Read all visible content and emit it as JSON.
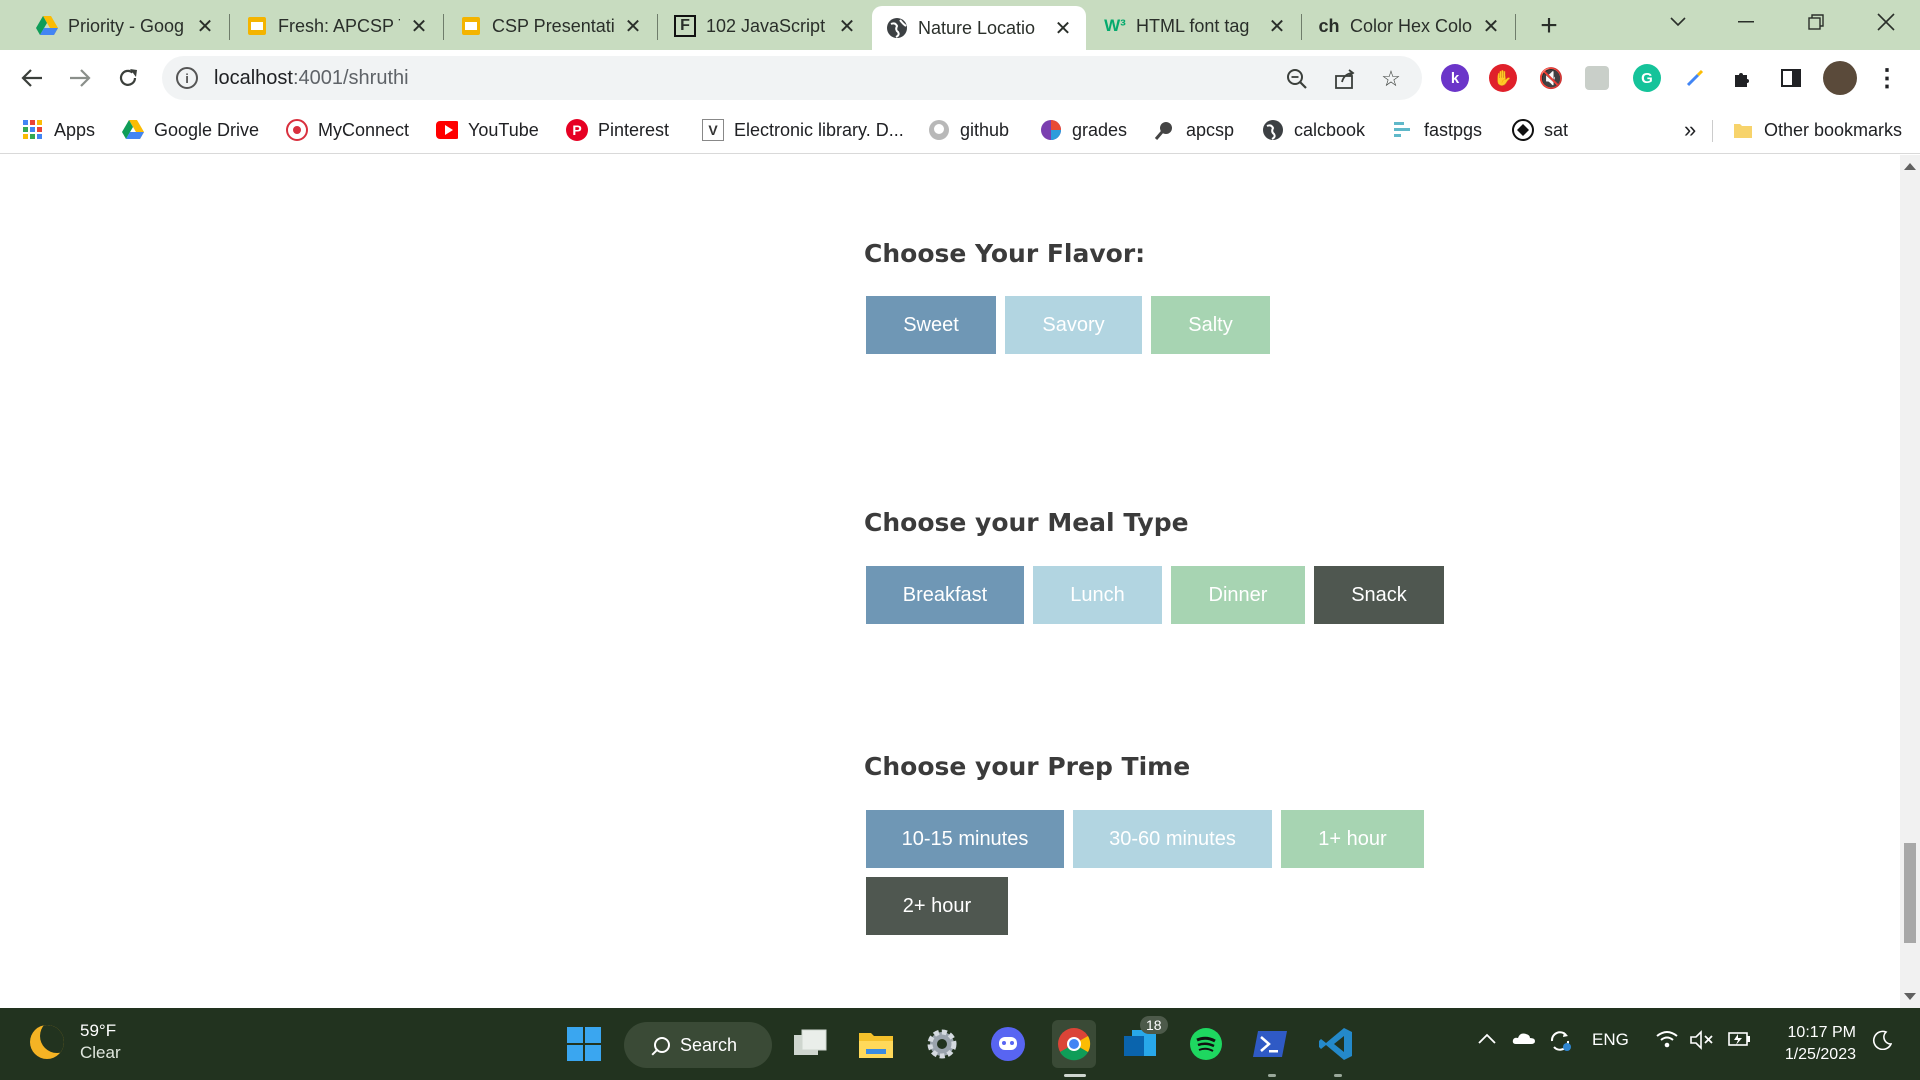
{
  "browser": {
    "tabs": [
      {
        "title": "Priority - Goog",
        "icon": "google-drive-icon",
        "active": false
      },
      {
        "title": "Fresh: APCSP T",
        "icon": "google-slides-icon",
        "active": false
      },
      {
        "title": "CSP Presentati",
        "icon": "google-slides-icon",
        "active": false
      },
      {
        "title": "102 JavaScript",
        "icon": "f-icon",
        "active": false
      },
      {
        "title": "Nature Locatio",
        "icon": "globe-icon",
        "active": true
      },
      {
        "title": "HTML font tag",
        "icon": "w3schools-icon",
        "active": false
      },
      {
        "title": "Color Hex Colo",
        "icon": "ch-icon",
        "active": false
      }
    ],
    "tab_icon_text": {
      "f": "F",
      "w3": "W³",
      "ch": "ch"
    },
    "new_tab": "+",
    "address": {
      "host": "localhost",
      "rest": ":4001/shruthi"
    },
    "bookmarks": [
      {
        "label": "Apps",
        "icon": "apps-grid-icon"
      },
      {
        "label": "Google Drive",
        "icon": "google-drive-icon"
      },
      {
        "label": "MyConnect",
        "icon": "myconnect-icon"
      },
      {
        "label": "YouTube",
        "icon": "youtube-icon"
      },
      {
        "label": "Pinterest",
        "icon": "pinterest-icon"
      },
      {
        "label": "Electronic library. D...",
        "icon": "v-icon"
      },
      {
        "label": "github",
        "icon": "github-icon"
      },
      {
        "label": "grades",
        "icon": "grades-icon"
      },
      {
        "label": "apcsp",
        "icon": "apcsp-icon"
      },
      {
        "label": "calcbook",
        "icon": "globe-icon"
      },
      {
        "label": "fastpgs",
        "icon": "fastpgs-icon"
      },
      {
        "label": "sat",
        "icon": "sat-icon"
      }
    ],
    "bookmark_icon_text": {
      "v": "V",
      "pinterest": "P"
    },
    "bookmarks_overflow": "»",
    "other_bookmarks": "Other bookmarks",
    "extension_text": {
      "k": "k",
      "grammarly": "G"
    }
  },
  "page": {
    "flavor": {
      "heading": "Choose Your Flavor:",
      "options": [
        "Sweet",
        "Savory",
        "Salty"
      ]
    },
    "meal": {
      "heading": "Choose your Meal Type",
      "options": [
        "Breakfast",
        "Lunch",
        "Dinner",
        "Snack"
      ]
    },
    "prep": {
      "heading": "Choose your Prep Time",
      "options": [
        "10-15 minutes",
        "30-60 minutes",
        "1+ hour",
        "2+ hour"
      ]
    },
    "colors": {
      "blue": "#6f97b5",
      "light_blue": "#b2d5e1",
      "green": "#a7d4b2",
      "dark": "#4f5750"
    }
  },
  "taskbar": {
    "weather": {
      "temp": "59°F",
      "condition": "Clear"
    },
    "search": "Search",
    "badge": "18",
    "language": "ENG",
    "time": "10:17 PM",
    "date": "1/25/2023"
  }
}
